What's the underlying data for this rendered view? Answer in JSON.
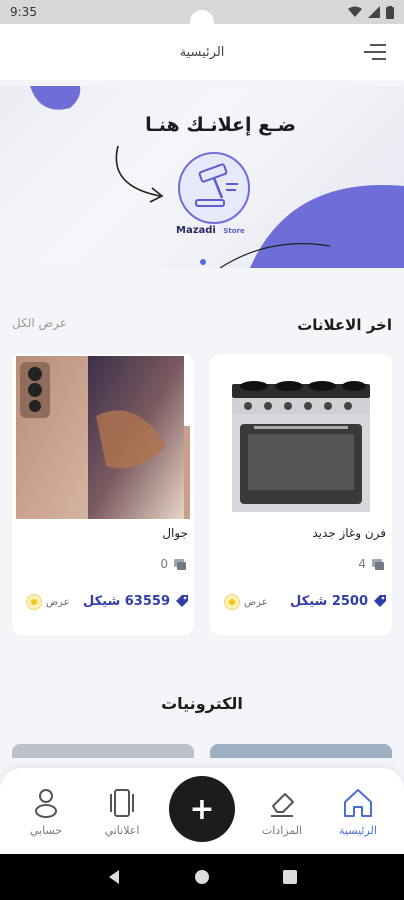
{
  "status_bar": {
    "time": "9:35"
  },
  "header": {
    "title": "الرئيسية"
  },
  "banner": {
    "headline": "ضـع إعلانـك هنـا",
    "brand": "Mazadi",
    "brand_sub": "Store"
  },
  "latest": {
    "title": "اخر الاعلانات",
    "view_all": "عرض الكل"
  },
  "ads": [
    {
      "name": "فرن وغاز جديد",
      "bids": "4",
      "price": "2500 شيكل",
      "offer_label": "عرض"
    },
    {
      "name": "جوال",
      "bids": "0",
      "price": "63559 شيكل",
      "offer_label": "عرض"
    }
  ],
  "category": {
    "title": "الكترونيات"
  },
  "nav": {
    "home": "الرئيسية",
    "auctions": "المزادات",
    "add": "+",
    "my_ads": "اعلاناتي",
    "account": "حسابي"
  },
  "colors": {
    "accent": "#4a6fd8",
    "price": "#2f3ea8",
    "banner_shape": "#6f6ed8",
    "fab": "#1c1c1c"
  }
}
